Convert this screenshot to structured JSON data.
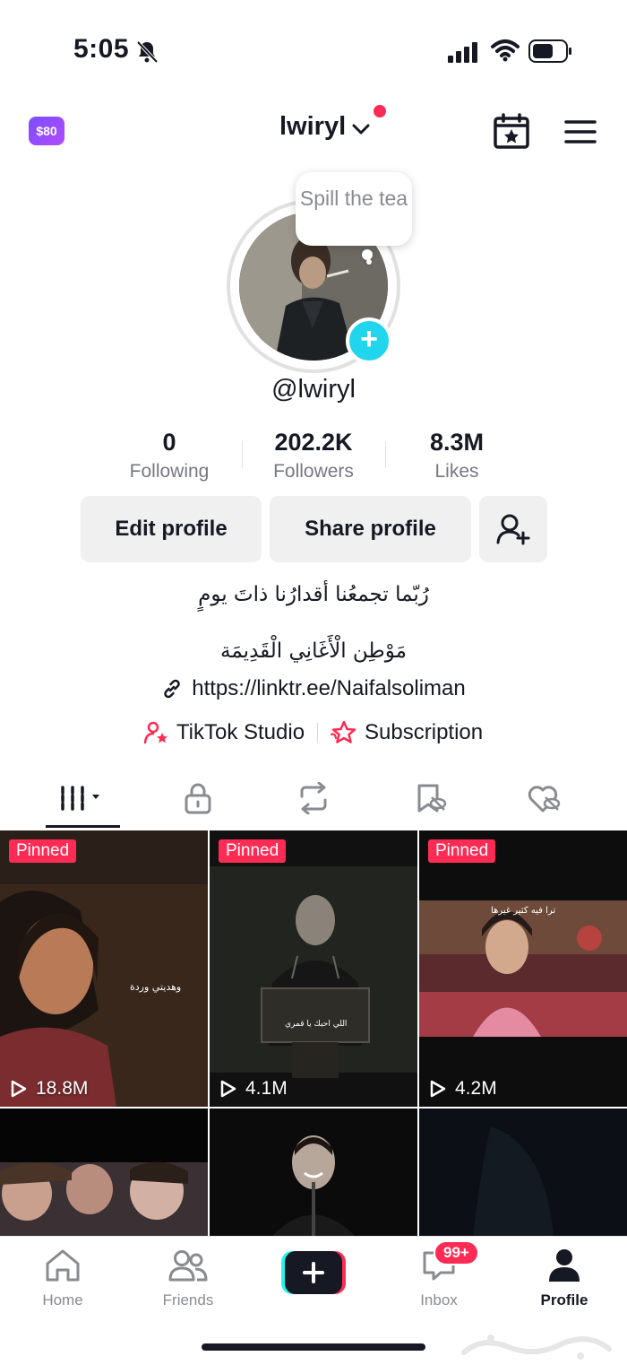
{
  "status_bar": {
    "time": "5:05"
  },
  "header": {
    "coins": "$80",
    "username": "lwiryl"
  },
  "profile": {
    "note": "Spill the tea",
    "handle": "@lwiryl",
    "stats": [
      {
        "value": "0",
        "label": "Following"
      },
      {
        "value": "202.2K",
        "label": "Followers"
      },
      {
        "value": "8.3M",
        "label": "Likes"
      }
    ],
    "edit_profile_label": "Edit profile",
    "share_profile_label": "Share profile",
    "bio_line1": "رُبّما تجمعُنا أقدارُنا ذاتَ يومٍ",
    "bio_line2": "مَوْطِن الْأَغَانِي الْقَدِيمَة",
    "link": "https://linktr.ee/Naifalsoliman",
    "tiktok_studio_label": "TikTok Studio",
    "subscription_label": "Subscription"
  },
  "videos": [
    {
      "pinned": "Pinned",
      "views": "18.8M",
      "caption": "وهديتي وردة"
    },
    {
      "pinned": "Pinned",
      "views": "4.1M",
      "caption": "اللي احبك يا قمري"
    },
    {
      "pinned": "Pinned",
      "views": "4.2M",
      "caption": "ترا فيه كثير غيرها"
    },
    {
      "pinned": "",
      "views": "",
      "caption": ""
    },
    {
      "pinned": "",
      "views": "",
      "caption": ""
    },
    {
      "pinned": "",
      "views": "",
      "caption": ""
    }
  ],
  "bottom_nav": {
    "items": [
      {
        "label": "Home",
        "icon": "home-icon"
      },
      {
        "label": "Friends",
        "icon": "friends-icon"
      },
      {
        "label": "",
        "icon": "plus-icon"
      },
      {
        "label": "Inbox",
        "icon": "inbox-icon",
        "badge": "99+"
      },
      {
        "label": "Profile",
        "icon": "profile-icon"
      }
    ]
  },
  "colors": {
    "accent": "#fe2c55",
    "teal": "#20d5ec",
    "text": "#161823",
    "muted": "#767781"
  }
}
